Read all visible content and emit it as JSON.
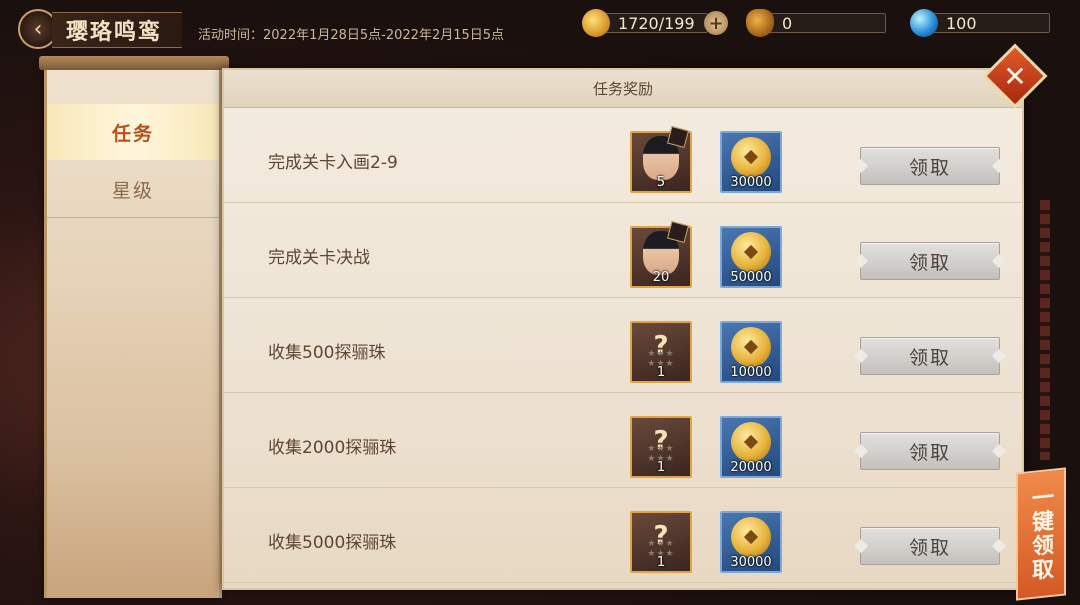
{
  "header": {
    "back_icon": "chevron-left-icon",
    "title": "璎珞鸣鸾",
    "activity_time": "活动时间：2022年1月28日5点-2022年2月15日5点"
  },
  "resources": {
    "gold": {
      "icon": "gold-coin-icon",
      "value": "1720/199"
    },
    "pot": {
      "icon": "golden-pot-icon",
      "value": "0"
    },
    "orb": {
      "icon": "blue-orb-icon",
      "value": "100"
    }
  },
  "tabs": [
    {
      "label": "任务",
      "selected": true
    },
    {
      "label": "星级",
      "selected": false
    }
  ],
  "panel": {
    "title": "任务奖励",
    "claim_label": "领取",
    "claim_all_label": "一键领取"
  },
  "tasks": [
    {
      "label": "完成关卡入画2-9",
      "reward1": {
        "type": "hero-shard",
        "qty": "5"
      },
      "reward2": {
        "type": "coin",
        "qty": "30000"
      }
    },
    {
      "label": "完成关卡决战",
      "reward1": {
        "type": "hero-shard",
        "qty": "20"
      },
      "reward2": {
        "type": "coin",
        "qty": "50000"
      }
    },
    {
      "label": "收集500探骊珠",
      "reward1": {
        "type": "mystery",
        "qty": "1"
      },
      "reward2": {
        "type": "coin",
        "qty": "10000"
      }
    },
    {
      "label": "收集2000探骊珠",
      "reward1": {
        "type": "mystery",
        "qty": "1"
      },
      "reward2": {
        "type": "coin",
        "qty": "20000"
      }
    },
    {
      "label": "收集5000探骊珠",
      "reward1": {
        "type": "mystery",
        "qty": "1"
      },
      "reward2": {
        "type": "coin",
        "qty": "30000"
      }
    }
  ],
  "colors": {
    "accent_tab": "#b8501c",
    "close_button": "#e25a2a",
    "claim_all": "#f08a4a"
  }
}
